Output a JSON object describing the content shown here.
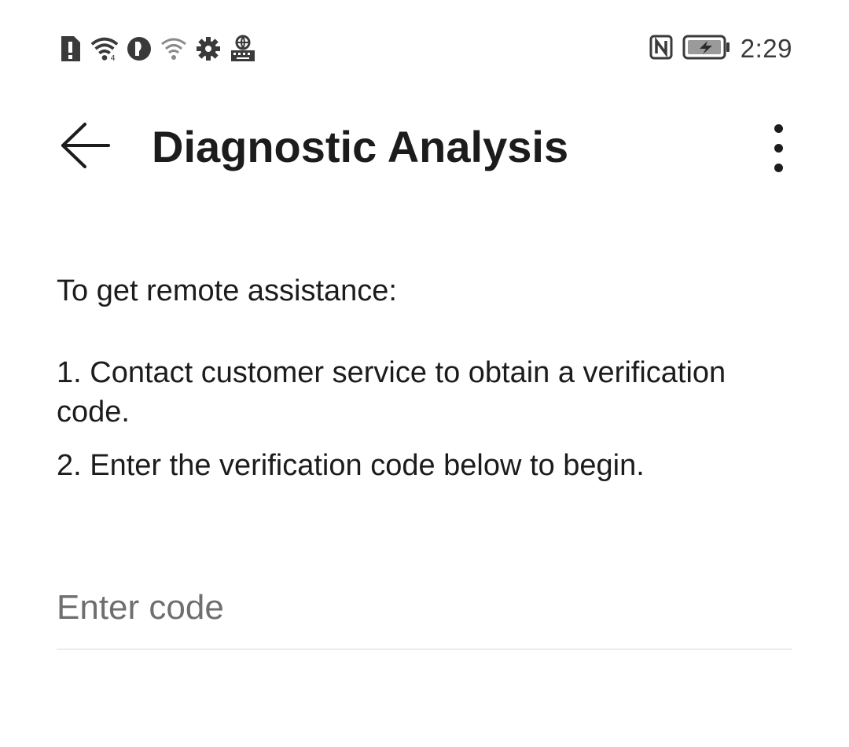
{
  "status_bar": {
    "time": "2:29",
    "icons_left": [
      "alert-icon",
      "wifi-icon",
      "vpn-key-icon",
      "wifi-weak-icon",
      "settings-gear-icon",
      "keyboard-globe-icon"
    ],
    "icons_right": [
      "nfc-icon",
      "battery-charging-icon"
    ]
  },
  "app_bar": {
    "title": "Diagnostic Analysis",
    "back_icon": "arrow-left-icon",
    "more_icon": "more-vertical-icon"
  },
  "content": {
    "intro": "To get remote assistance:",
    "steps": [
      "1. Contact customer service to obtain a verification code.",
      "2. Enter the verification code below to begin."
    ]
  },
  "code_input": {
    "placeholder": "Enter code",
    "value": ""
  }
}
